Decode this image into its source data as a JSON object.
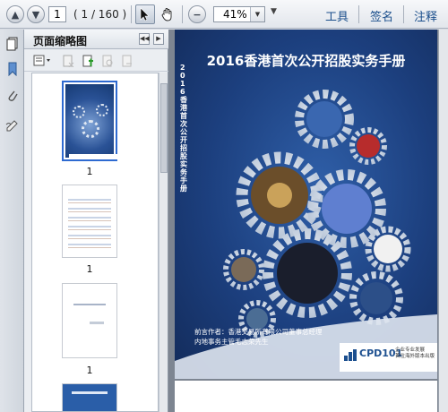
{
  "toolbar": {
    "page_current": "1",
    "page_count": "( 1 / 160 )",
    "zoom": "41%",
    "links": [
      "工具",
      "签名",
      "注释"
    ]
  },
  "sidebar": {
    "title": "页面缩略图",
    "thumbnails": [
      {
        "label": "1",
        "kind": "cover"
      },
      {
        "label": "1",
        "kind": "logos"
      },
      {
        "label": "1",
        "kind": "text"
      },
      {
        "label": "",
        "kind": "partial"
      }
    ]
  },
  "document": {
    "title": "2016香港首次公开招股实务手册",
    "vertical_title": "2016香港首次公开招股实务手册",
    "authors_line1": "前言作者：香港交易所有限公司董事总经理",
    "authors_line2": "内地事务主管毛志荣先生",
    "badge_main": "CPD101",
    "badge_sub1": "企业专业发展",
    "badge_sub2": "首位海外版本出版"
  },
  "icons": [
    "upload-icon",
    "download-icon",
    "select-cursor-icon",
    "hand-icon",
    "zoom-out-icon",
    "page-thumbnails-icon",
    "bookmark-icon",
    "attachment-icon",
    "signature-icon",
    "options-icon",
    "delete-icon",
    "insert-icon",
    "undo-icon",
    "redo-icon",
    "print-icon"
  ],
  "colors": {
    "accent": "#1a4e8c",
    "cover_blue": "#1c3f7e"
  }
}
